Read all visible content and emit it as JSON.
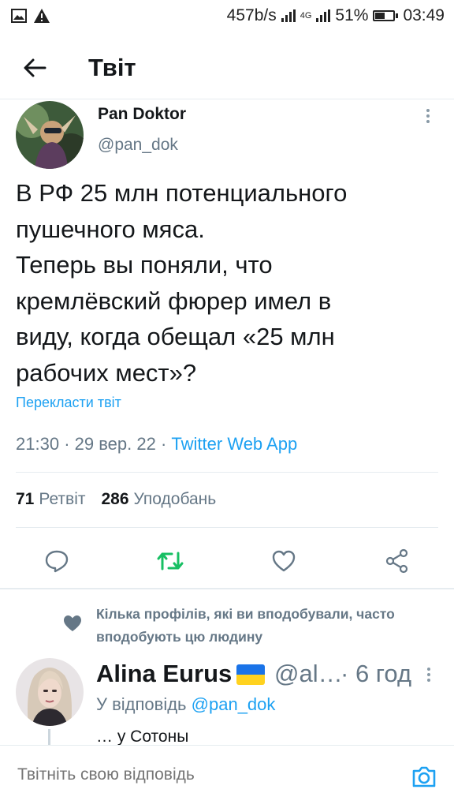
{
  "status_bar": {
    "network_speed": "457b/s",
    "network_type": "4G",
    "battery_percent": "51%",
    "battery_level": 0.51,
    "time": "03:49",
    "left_icons": [
      "image-icon",
      "warning-icon"
    ]
  },
  "header": {
    "back_icon": "arrow-left-icon",
    "title": "Твіт"
  },
  "tweet": {
    "author_name": "Pan Doktor",
    "author_handle": "@pan_dok",
    "text": "В РФ 25 млн потенциального\nпушечного мяса.\nТеперь вы поняли, что\nкремлёвский фюрер имел в\nвиду, когда обещал «25 млн\nрабочих мест»?",
    "translate_label": "Перекласти твіт",
    "time": "21:30",
    "date": "29 вер. 22",
    "source": "Twitter Web App",
    "retweets_count": "71",
    "retweets_label": "Ретвіт",
    "likes_count": "286",
    "likes_label": "Уподобань"
  },
  "actions": {
    "icons": [
      "reply-icon",
      "retweet-icon",
      "like-icon",
      "share-icon"
    ],
    "retweet_color": "#17bf63"
  },
  "social_context": {
    "text": "Кілька профілів, які ви вподобували, часто вподобують цю людину"
  },
  "reply": {
    "name": "Alina Eurus",
    "handle": "@al…",
    "time": "6 год",
    "replying_to_label": "У відповідь",
    "replying_to_mention": "@pan_dok",
    "text": "… у Сотоны"
  },
  "composer": {
    "placeholder": "Твітніть свою відповідь"
  },
  "colors": {
    "accent": "#1da1f2",
    "secondary_text": "#657786",
    "divider": "#e6ecf0"
  }
}
